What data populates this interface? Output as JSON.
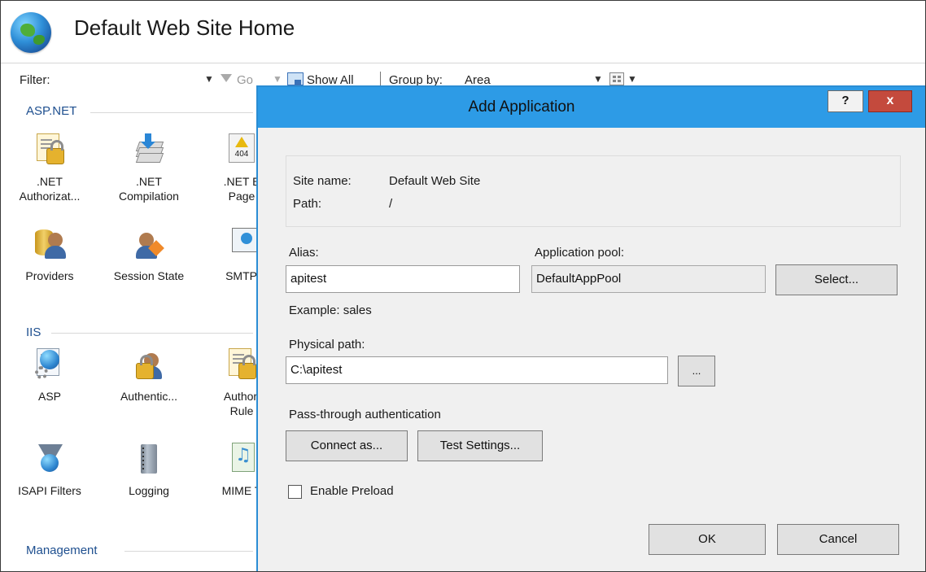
{
  "window": {
    "title": "Default Web Site Home",
    "icon": "globe-icon"
  },
  "toolbar": {
    "filter_label": "Filter:",
    "go_label": "Go",
    "show_all_label": "Show All",
    "group_by_label": "Group by:",
    "group_by_value": "Area"
  },
  "features": {
    "groups": [
      {
        "name": "ASP.NET"
      },
      {
        "name": "IIS"
      },
      {
        "name": "Management"
      }
    ],
    "aspnet": [
      {
        "line1": ".NET",
        "line2": "Authorizat...",
        "icon": "lock-document-icon"
      },
      {
        "line1": ".NET",
        "line2": "Compilation",
        "icon": "compilation-icon"
      },
      {
        "line1": ".NET E",
        "line2": "Page",
        "icon": "error-pages-icon"
      },
      {
        "line1": "Providers",
        "line2": "",
        "icon": "providers-icon"
      },
      {
        "line1": "Session State",
        "line2": "",
        "icon": "session-state-icon"
      },
      {
        "line1": "SMTP E",
        "line2": "",
        "icon": "smtp-email-icon"
      }
    ],
    "iis": [
      {
        "line1": "ASP",
        "line2": "",
        "icon": "asp-icon"
      },
      {
        "line1": "Authentic...",
        "line2": "",
        "icon": "authentication-icon"
      },
      {
        "line1": "Authori",
        "line2": "Rule",
        "icon": "authorization-rules-icon"
      },
      {
        "line1": "ISAPI Filters",
        "line2": "",
        "icon": "isapi-filters-icon"
      },
      {
        "line1": "Logging",
        "line2": "",
        "icon": "logging-icon"
      },
      {
        "line1": "MIME T",
        "line2": "",
        "icon": "mime-types-icon"
      }
    ]
  },
  "dialog": {
    "title": "Add Application",
    "help_label": "?",
    "close_label": "x",
    "site_name_label": "Site name:",
    "site_name_value": "Default Web Site",
    "path_label": "Path:",
    "path_value": "/",
    "alias_label": "Alias:",
    "alias_value": "apitest",
    "app_pool_label": "Application pool:",
    "app_pool_value": "DefaultAppPool",
    "select_label": "Select...",
    "example_text": "Example: sales",
    "physical_path_label": "Physical path:",
    "physical_path_value": "C:\\apitest",
    "browse_label": "...",
    "pass_through_label": "Pass-through authentication",
    "connect_as_label": "Connect as...",
    "test_settings_label": "Test Settings...",
    "enable_preload_label": "Enable Preload",
    "enable_preload_checked": false,
    "ok_label": "OK",
    "cancel_label": "Cancel"
  },
  "colors": {
    "title_bar": "#2d9be6",
    "close_button": "#c44a3d",
    "group_header": "#1e4f8f"
  }
}
